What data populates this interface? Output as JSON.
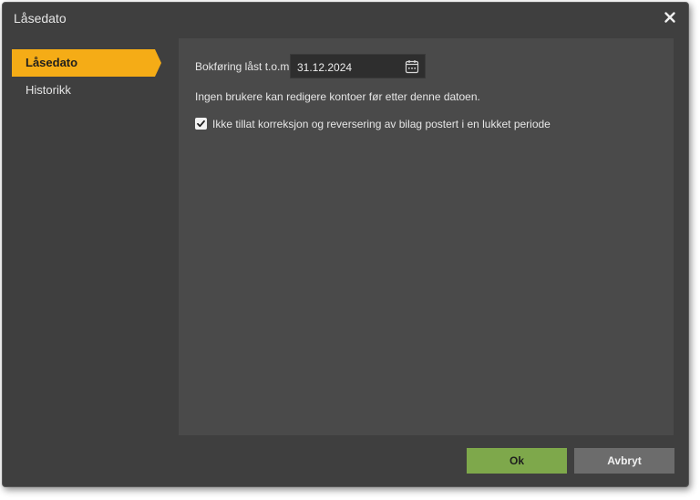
{
  "dialog": {
    "title": "Låsedato",
    "close_icon": "close-icon"
  },
  "sidebar": {
    "items": [
      {
        "label": "Låsedato",
        "active": true
      },
      {
        "label": "Historikk",
        "active": false
      }
    ]
  },
  "content": {
    "date_label": "Bokføring låst t.o.m",
    "date_value": "31.12.2024",
    "date_icon": "calendar-icon",
    "info_text": "Ingen brukere kan redigere kontoer før etter denne datoen.",
    "checkbox": {
      "checked": true,
      "label": "Ikke tillat korreksjon og reversering av bilag postert i en lukket periode"
    }
  },
  "buttons": {
    "ok": "Ok",
    "cancel": "Avbryt"
  },
  "colors": {
    "active_tab": "#f5ac16",
    "ok_button": "#7ea84b",
    "cancel_button": "#6c6c6c",
    "dialog_bg": "#3f3f3f",
    "panel_bg": "#4a4a4a"
  }
}
